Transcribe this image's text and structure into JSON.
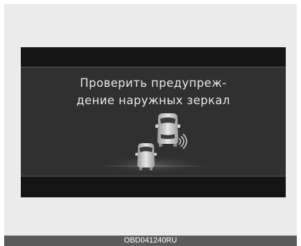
{
  "warning": {
    "line1": "Проверить предупреж-",
    "line2": "дение наружных зеркал"
  },
  "footer": {
    "code": "OBD041240RU"
  },
  "colors": {
    "screen_bg": "#1f1f1f",
    "panel_bg": "#303030",
    "text": "#e8e8e8",
    "car": "#d8d8d8"
  },
  "graphic": {
    "icon": "blind-spot-warning-icon"
  }
}
